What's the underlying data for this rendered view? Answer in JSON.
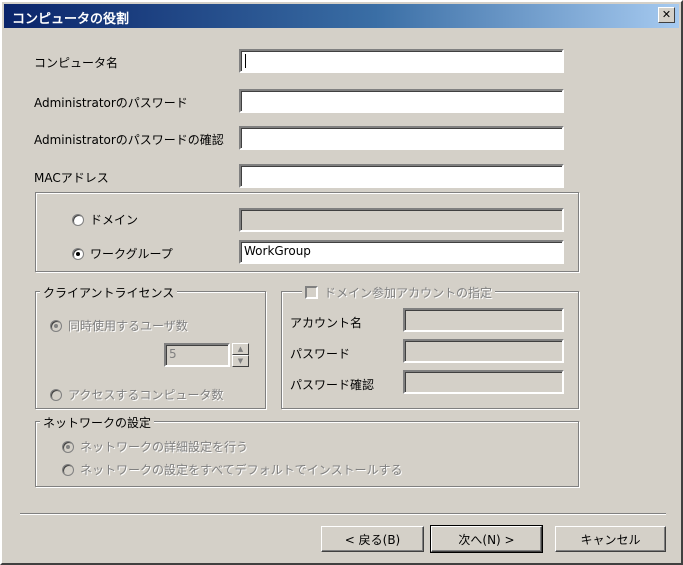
{
  "window": {
    "title": "コンピュータの役割",
    "close_label": "✕"
  },
  "form": {
    "computer_name_label": "コンピュータ名",
    "computer_name_value": "",
    "admin_password_label": "Administratorのパスワード",
    "admin_password_value": "",
    "admin_password_confirm_label": "Administratorのパスワードの確認",
    "admin_password_confirm_value": "",
    "mac_address_label": "MACアドレス",
    "mac_address_value": ""
  },
  "membership": {
    "domain_label": "ドメイン",
    "domain_value": "",
    "workgroup_label": "ワークグループ",
    "workgroup_value": "WorkGroup",
    "selected": "workgroup"
  },
  "client_license": {
    "legend": "クライアントライセンス",
    "per_user_label": "同時使用するユーザ数",
    "user_count": "5",
    "per_computer_label": "アクセスするコンピュータ数"
  },
  "domain_account": {
    "legend": "ドメイン参加アカウントの指定",
    "account_label": "アカウント名",
    "account_value": "",
    "password_label": "パスワード",
    "password_value": "",
    "password_confirm_label": "パスワード確認",
    "password_confirm_value": ""
  },
  "network": {
    "legend": "ネットワークの設定",
    "detailed_label": "ネットワークの詳細設定を行う",
    "default_label": "ネットワークの設定をすべてデフォルトでインストールする"
  },
  "buttons": {
    "back_label": "< 戻る(B)",
    "next_label": "次へ(N) >",
    "cancel_label": "キャンセル"
  },
  "icons": {
    "close": "close-icon",
    "spin_up": "spin-up-icon",
    "spin_down": "spin-down-icon"
  },
  "colors": {
    "dialog_bg": "#d4d0c8",
    "titlebar_start": "#0a246a",
    "titlebar_end": "#a6caf0",
    "disabled_text": "#808080"
  }
}
